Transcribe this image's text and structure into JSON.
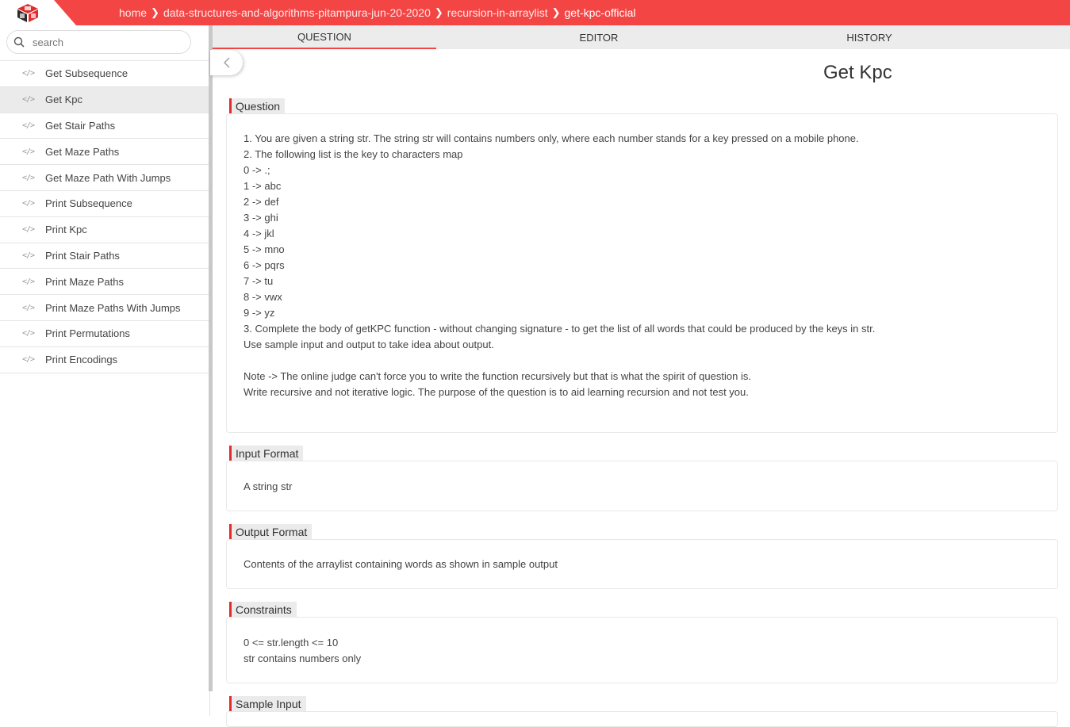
{
  "breadcrumb": [
    "home",
    "data-structures-and-algorithms-pitampura-jun-20-2020",
    "recursion-in-arraylist",
    "get-kpc-official"
  ],
  "search": {
    "placeholder": "search"
  },
  "sidebar": {
    "items": [
      {
        "label": "Get Subsequence"
      },
      {
        "label": "Get Kpc"
      },
      {
        "label": "Get Stair Paths"
      },
      {
        "label": "Get Maze Paths"
      },
      {
        "label": "Get Maze Path With Jumps"
      },
      {
        "label": "Print Subsequence"
      },
      {
        "label": "Print Kpc"
      },
      {
        "label": "Print Stair Paths"
      },
      {
        "label": "Print Maze Paths"
      },
      {
        "label": "Print Maze Paths With Jumps"
      },
      {
        "label": "Print Permutations"
      },
      {
        "label": "Print Encodings"
      }
    ],
    "code_icon": "</>"
  },
  "tabs": {
    "question": "QUESTION",
    "editor": "EDITOR",
    "history": "HISTORY"
  },
  "page": {
    "title": "Get Kpc"
  },
  "sections": {
    "question": {
      "label": "Question",
      "lines": [
        "1. You are given a string str. The string str will contains numbers only, where each number stands for a key pressed on a mobile phone.",
        "2. The following list is the key to characters map",
        "0 -> .;",
        "1 -> abc",
        "2 -> def",
        "3 -> ghi",
        "4 -> jkl",
        "5 -> mno",
        "6 -> pqrs",
        "7 -> tu",
        "8 -> vwx",
        "9 -> yz",
        "3. Complete the body of getKPC function - without changing signature - to get the list of all words that could be produced by the keys in str.",
        "Use sample input and output to take idea about output.",
        "",
        "Note -> The online judge can't force you to write the function recursively but that is what the spirit of question is.",
        "Write recursive and not iterative logic. The purpose of the question is to aid learning recursion and not test you."
      ]
    },
    "input_format": {
      "label": "Input Format",
      "lines": [
        "A string str"
      ]
    },
    "output_format": {
      "label": "Output Format",
      "lines": [
        "Contents of the arraylist containing words as shown in sample output"
      ]
    },
    "constraints": {
      "label": "Constraints",
      "lines": [
        "0 <= str.length <= 10",
        "str contains numbers only"
      ]
    },
    "sample_input": {
      "label": "Sample Input"
    }
  },
  "colors": {
    "brand": "#f44545",
    "accent": "#e02c2c"
  }
}
